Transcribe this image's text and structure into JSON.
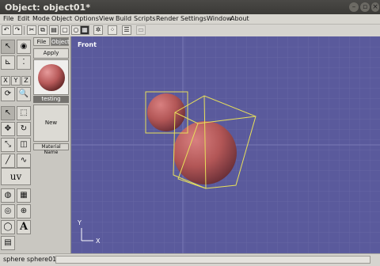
{
  "window": {
    "title": "Object: object01*"
  },
  "menu": [
    "File",
    "Edit",
    "Mode",
    "Object",
    "Options",
    "View",
    "Build",
    "Scripts",
    "Render",
    "Settings",
    "Window",
    "About"
  ],
  "panel": {
    "tabs": [
      "File",
      "Object"
    ],
    "apply": "Apply",
    "caption": "testing",
    "new": "New",
    "material_name": "Material Name"
  },
  "tools": {
    "x": "X",
    "y": "Y",
    "z": "Z",
    "uv": "uv",
    "text": "A"
  },
  "viewport": {
    "label": "Front",
    "axis_x": "X",
    "axis_y": "Y",
    "background": "#5a5a9c",
    "grid_color": "#6a6aa8",
    "sphere_color": "#c06060",
    "selection_color": "#e8e05a"
  },
  "status": {
    "text": "sphere  sphere01"
  }
}
